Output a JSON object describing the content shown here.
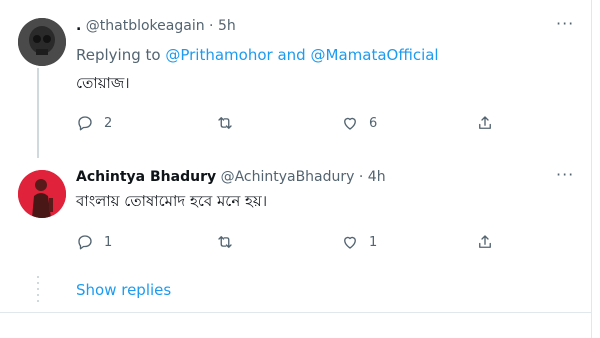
{
  "tweets": [
    {
      "display_name": ".",
      "handle": "@thatblokeagain",
      "separator": "·",
      "time": "5h",
      "replying_prefix": "Replying to",
      "replying_user1": "@Prithamohor",
      "replying_and": "and",
      "replying_user2": "@MamataOfficial",
      "text": "তোয়াজ।",
      "more": "···",
      "reply_count": "2",
      "retweet_count": "",
      "like_count": "6"
    },
    {
      "display_name": "Achintya Bhadury",
      "handle": "@AchintyaBhadury",
      "separator": "·",
      "time": "4h",
      "text": "বাংলায় তোষামোদ হবে মনে হয়।",
      "more": "···",
      "reply_count": "1",
      "retweet_count": "",
      "like_count": "1"
    }
  ],
  "show_replies": "Show replies",
  "icons": [
    "avatar",
    "more-icon",
    "reply-icon",
    "retweet-icon",
    "like-icon",
    "share-icon"
  ],
  "colors": {
    "accent": "#1d9bf0",
    "muted": "#536471",
    "text": "#0f1419"
  }
}
